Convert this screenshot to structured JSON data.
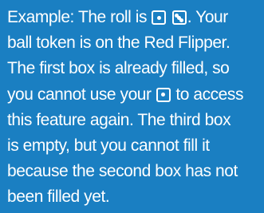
{
  "example": {
    "line1_a": "Example: The roll is ",
    "line1_b": ". Your",
    "line2": "ball token is on the Red Flipper.",
    "line3": "The first box is already filled, so",
    "line4_a": "you cannot use your ",
    "line4_b": " to access",
    "line5": "this feature again. The third box",
    "line6": "is empty, but you cannot fill it",
    "line7": "because the second box has not",
    "line8": "been filled yet."
  },
  "dice": {
    "roll": [
      1,
      3
    ],
    "referenced": 1
  },
  "colors": {
    "background": "#1a7fc2",
    "text": "#ffffff"
  }
}
